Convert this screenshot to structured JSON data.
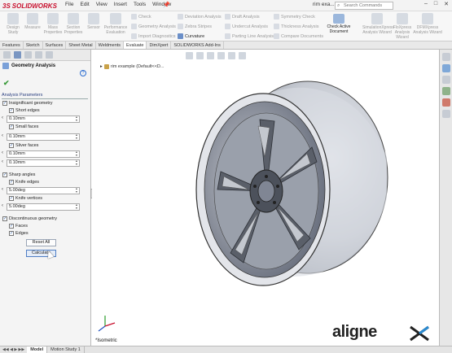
{
  "app": {
    "logo_ds": "3S",
    "logo_name": "SOLIDWORKS",
    "document_title": "rim exa...",
    "search_placeholder": "Search Commands"
  },
  "menus": [
    "File",
    "Edit",
    "View",
    "Insert",
    "Tools",
    "Window"
  ],
  "command_manager": {
    "big": [
      {
        "label": "Design Study",
        "icon": "design-study-icon"
      },
      {
        "label": "Measure",
        "icon": "measure-icon"
      },
      {
        "label": "Mass Properties",
        "icon": "mass-properties-icon"
      },
      {
        "label": "Section Properties",
        "icon": "section-properties-icon"
      },
      {
        "label": "Sensor",
        "icon": "sensor-icon"
      },
      {
        "label": "Performance Evaluation",
        "icon": "performance-icon"
      }
    ],
    "small": [
      {
        "label": "Check",
        "active": false
      },
      {
        "label": "Geometry Analysis",
        "active": false
      },
      {
        "label": "Import Diagnostics",
        "active": false
      },
      {
        "label": "Deviation Analysis",
        "active": false
      },
      {
        "label": "Zebra Stripes",
        "active": false
      },
      {
        "label": "Curvature",
        "active": true
      },
      {
        "label": "Draft Analysis",
        "active": false
      },
      {
        "label": "Undercut Analysis",
        "active": false
      },
      {
        "label": "Parting Line Analysis",
        "active": false
      },
      {
        "label": "Symmetry Check",
        "active": false
      },
      {
        "label": "Thickness Analysis",
        "active": false
      },
      {
        "label": "Compare Documents",
        "active": false
      }
    ],
    "check_active": "Check Active Document",
    "right_big": [
      {
        "label": "SimulationXpress Analysis Wizard"
      },
      {
        "label": "FloXpress Analysis Wizard"
      },
      {
        "label": "DFMXpress Analysis Wizard"
      }
    ]
  },
  "tabs": [
    {
      "label": "Features",
      "active": false
    },
    {
      "label": "Sketch",
      "active": false
    },
    {
      "label": "Surfaces",
      "active": false
    },
    {
      "label": "Sheet Metal",
      "active": false
    },
    {
      "label": "Weldments",
      "active": false
    },
    {
      "label": "Evaluate",
      "active": true
    },
    {
      "label": "DimXpert",
      "active": false
    },
    {
      "label": "SOLIDWORKS Add-Ins",
      "active": false
    }
  ],
  "panel": {
    "title": "Geometry Analysis",
    "section": "Analysis Parameters",
    "insignificant": "Insignificant geometry",
    "short_edges": "Short edges",
    "short_edges_value": "0.10mm",
    "small_faces": "Small faces",
    "small_faces_value": "0.10mm",
    "sliver_faces": "Sliver faces",
    "sliver_faces_value": "0.10mm",
    "sliver_faces_value2": "0.10mm",
    "sharp_angles": "Sharp angles",
    "knife_edges": "Knife edges",
    "knife_edges_value": "5.00deg",
    "knife_vertices": "Knife vertices",
    "knife_vertices_value": "5.00deg",
    "discontinuous": "Discontinuous geometry",
    "faces": "Faces",
    "edges": "Edges",
    "reset_all": "Reset All",
    "calculate": "Calculate"
  },
  "viewport": {
    "breadcrumb": "rim example (Default<<D...",
    "orientation": "*Isometric",
    "brand": "aligne"
  },
  "bottom_tabs": [
    {
      "label": "Model",
      "active": true
    },
    {
      "label": "Motion Study 1",
      "active": false
    }
  ]
}
